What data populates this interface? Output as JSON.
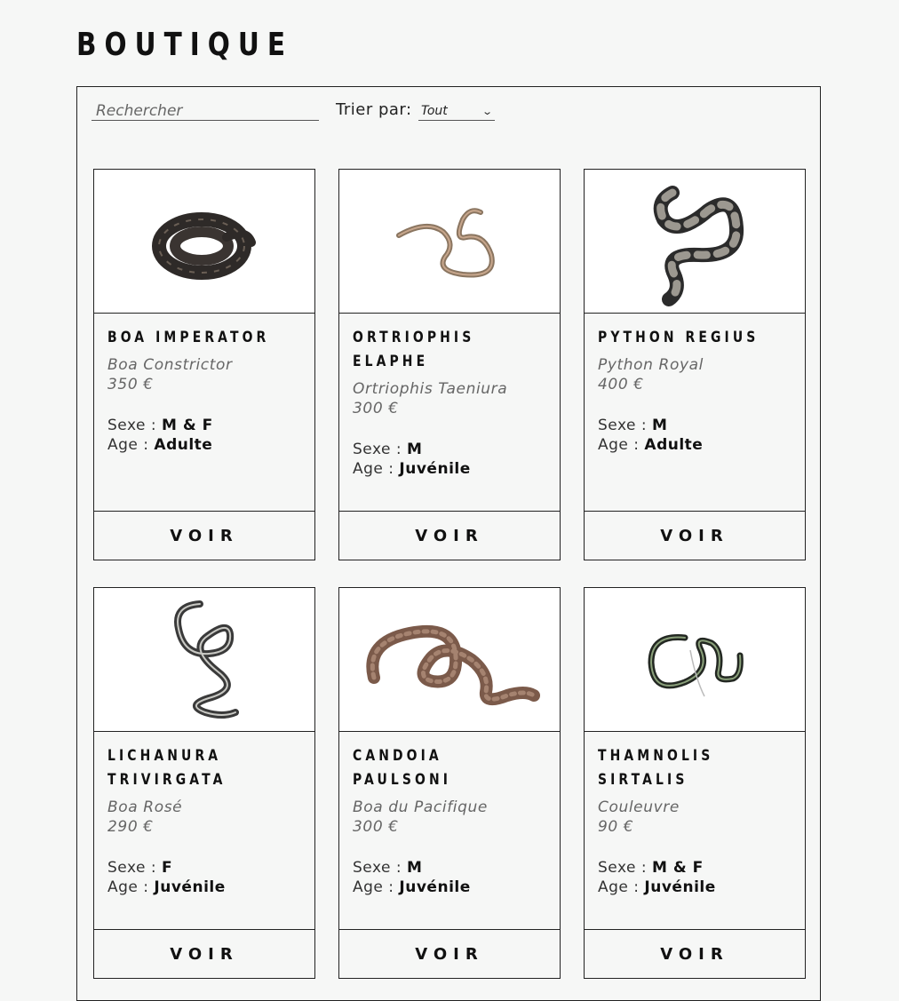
{
  "page_title": "BOUTIQUE",
  "search": {
    "placeholder": "Rechercher",
    "value": ""
  },
  "sort": {
    "label": "Trier par:",
    "selected": "Tout"
  },
  "button_label": "VOIR",
  "sexe_label": "Sexe :",
  "age_label": "Age :",
  "products": [
    {
      "name": "BOA IMPERATOR",
      "common": "Boa Constrictor",
      "price": "350 €",
      "sexe": "M & F",
      "age": "Adulte",
      "image": "boa-imperator-image"
    },
    {
      "name": "ORTRIOPHIS ELAPHE",
      "common": "Ortriophis Taeniura",
      "price": "300 €",
      "sexe": "M",
      "age": "Juvénile",
      "image": "ortriophis-elaphe-image"
    },
    {
      "name": "PYTHON REGIUS",
      "common": "Python Royal",
      "price": "400 €",
      "sexe": "M",
      "age": "Adulte",
      "image": "python-regius-image"
    },
    {
      "name": "LICHANURA TRIVIRGATA",
      "common": "Boa Rosé",
      "price": "290 €",
      "sexe": "F",
      "age": "Juvénile",
      "image": "lichanura-trivirgata-image"
    },
    {
      "name": "CANDOIA PAULSONI",
      "common": "Boa du Pacifique",
      "price": "300 €",
      "sexe": "M",
      "age": "Juvénile",
      "image": "candoia-paulsoni-image"
    },
    {
      "name": "THAMNOLIS SIRTALIS",
      "common": "Couleuvre",
      "price": "90 €",
      "sexe": "M & F",
      "age": "Juvénile",
      "image": "thamnolis-sirtalis-image"
    }
  ]
}
